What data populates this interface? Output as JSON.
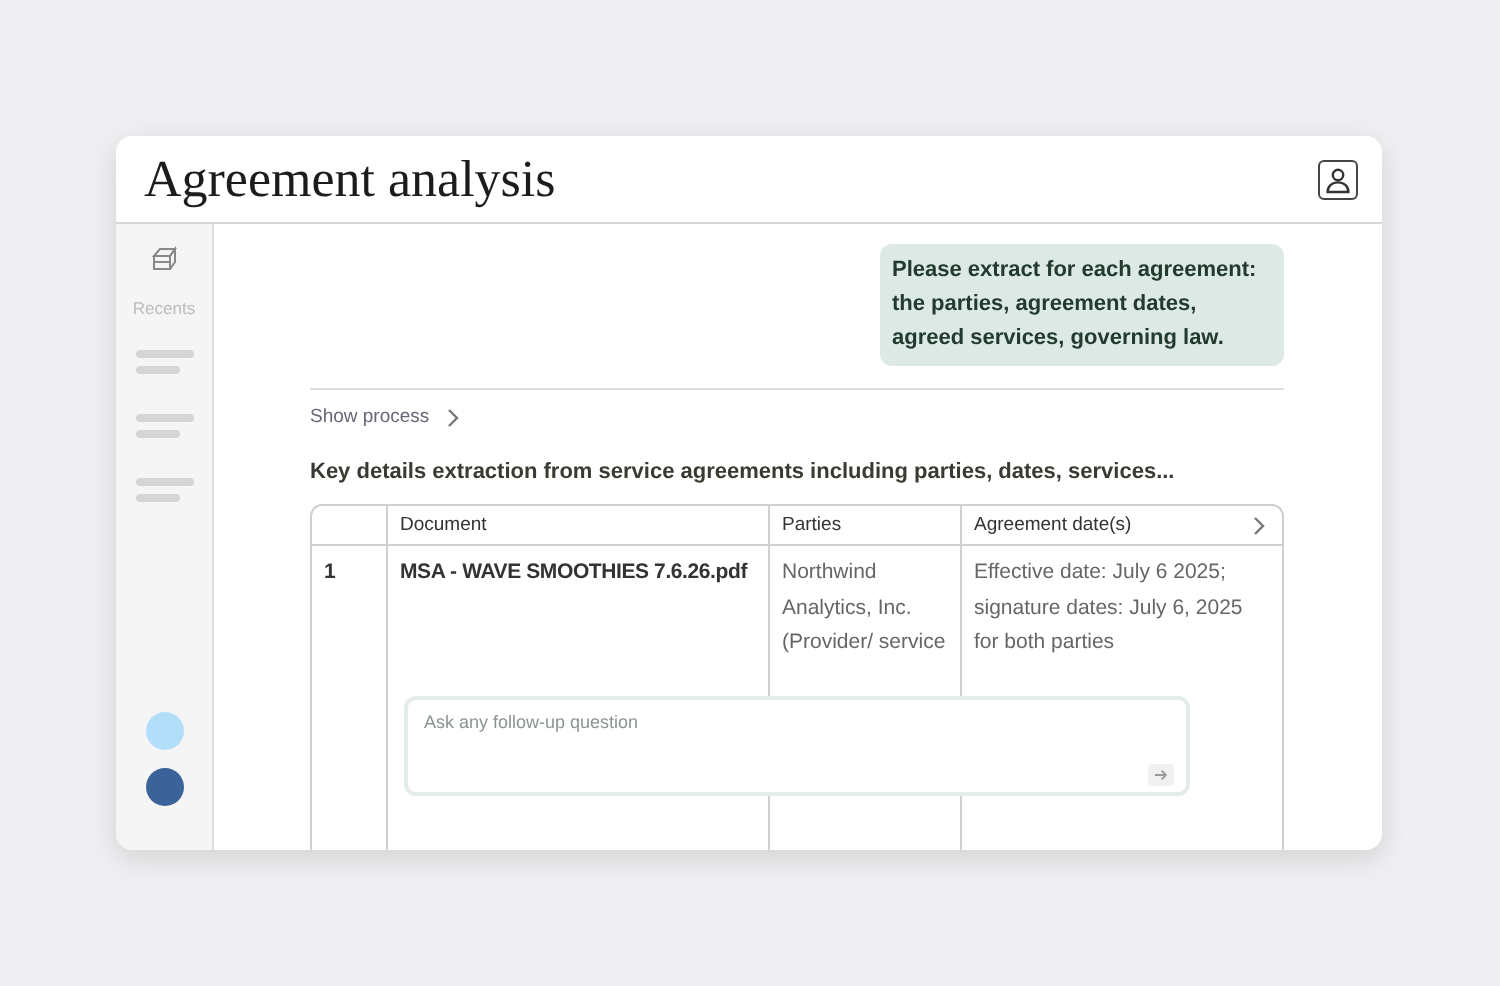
{
  "window": {
    "title": "Agreement analysis"
  },
  "sidebar": {
    "recents_label": "Recents"
  },
  "message": {
    "text": "Please extract for each agreement: the parties, agreement dates, agreed services, governing law."
  },
  "show_process": {
    "label": "Show process",
    "expanded": false
  },
  "result_title": "Key details extraction from service agreements including parties, dates, services...",
  "table": {
    "columns": [
      "",
      "Document",
      "Parties",
      "Agreement date(s)"
    ],
    "rows": [
      {
        "cells": [
          "1",
          "MSA - WAVE SMOOTHIES 7.6.26.pdf",
          "Northwind Analytics, Inc. (Provider/ service",
          "Effective date: July 6 2025; signature dates: July 6, 2025 for both parties"
        ]
      }
    ]
  },
  "followup": {
    "placeholder": "Ask any follow-up question"
  }
}
